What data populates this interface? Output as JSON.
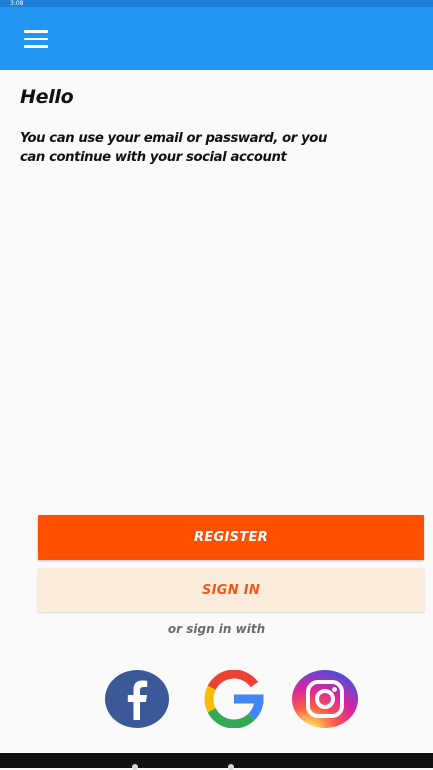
{
  "status_bar": {
    "time": "3:08"
  },
  "app_bar": {
    "menu_icon": "hamburger-menu-icon",
    "color": "#2196f3"
  },
  "content": {
    "greeting": "Hello",
    "intro_text": "You can use your email or passward, or you can continue with your social account"
  },
  "buttons": {
    "register_label": "REGISTER",
    "signin_label": "SIGN IN",
    "register_color": "#ff5000",
    "signin_color": "#fbebdb"
  },
  "social": {
    "prompt": "or sign in with",
    "providers": [
      "facebook-icon",
      "google-icon",
      "instagram-icon"
    ]
  }
}
